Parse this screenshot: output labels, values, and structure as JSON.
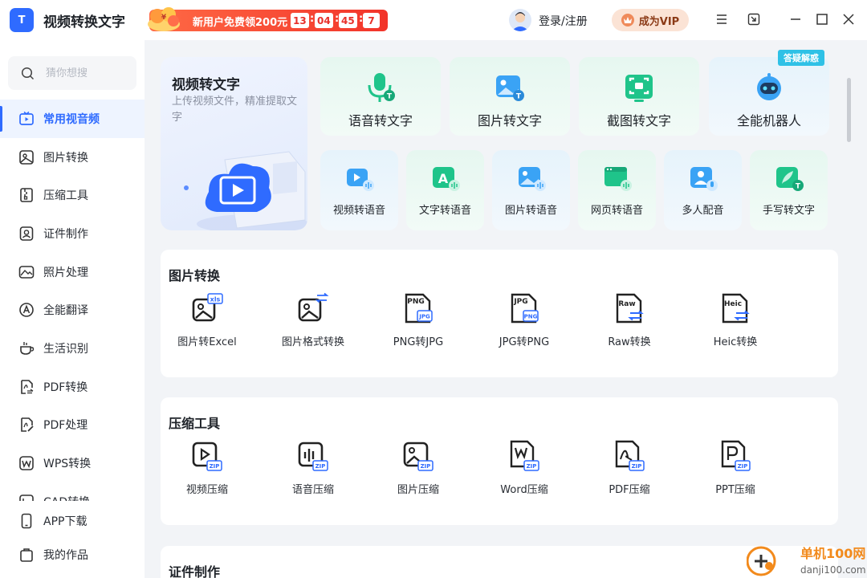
{
  "app": {
    "logo_text": "T",
    "title": "视频转换文字"
  },
  "promo": {
    "text_prefix": "新用户免费领",
    "amount": "200元",
    "timer": [
      "13",
      "04",
      "45",
      "7"
    ]
  },
  "header": {
    "login_label": "登录/注册",
    "vip_label": "成为VIP"
  },
  "sidebar": {
    "search_placeholder": "猜你想搜",
    "items": [
      {
        "label": "常用视音频",
        "icon": "video-icon",
        "active": true
      },
      {
        "label": "图片转换",
        "icon": "image-icon"
      },
      {
        "label": "压缩工具",
        "icon": "zip-icon"
      },
      {
        "label": "证件制作",
        "icon": "id-photo-icon"
      },
      {
        "label": "照片处理",
        "icon": "photo-icon"
      },
      {
        "label": "全能翻译",
        "icon": "translate-icon"
      },
      {
        "label": "生活识别",
        "icon": "cup-icon"
      },
      {
        "label": "PDF转换",
        "icon": "pdf-convert-icon"
      },
      {
        "label": "PDF处理",
        "icon": "pdf-edit-icon"
      },
      {
        "label": "WPS转换",
        "icon": "wps-icon"
      },
      {
        "label": "CAD转换",
        "icon": "cad-icon"
      }
    ],
    "bottom": [
      {
        "label": "APP下载",
        "icon": "phone-icon"
      },
      {
        "label": "我的作品",
        "icon": "bag-icon"
      }
    ]
  },
  "hero": {
    "title": "视频转文字",
    "description": "上传视频文件，精准提取文字"
  },
  "featured_big": [
    {
      "label": "语音转文字",
      "icon": "microphone-icon",
      "color": "#1fc48a"
    },
    {
      "label": "图片转文字",
      "icon": "image-text-icon",
      "color": "#3aa3f5"
    },
    {
      "label": "截图转文字",
      "icon": "screenshot-icon",
      "color": "#1fc48a"
    },
    {
      "label": "全能机器人",
      "icon": "robot-icon",
      "color": "#3aa3f5"
    }
  ],
  "badge_help": "答疑解惑",
  "featured_small": [
    {
      "label": "视频转语音",
      "icon": "video-voice-icon",
      "color": "#3aa3f5"
    },
    {
      "label": "文字转语音",
      "icon": "text-voice-icon",
      "color": "#1fc48a"
    },
    {
      "label": "图片转语音",
      "icon": "image-voice-icon",
      "color": "#3aa3f5"
    },
    {
      "label": "网页转语音",
      "icon": "web-voice-icon",
      "color": "#1fc48a"
    },
    {
      "label": "多人配音",
      "icon": "dubbing-icon",
      "color": "#3aa3f5"
    },
    {
      "label": "手写转文字",
      "icon": "handwriting-icon",
      "color": "#1fc48a"
    }
  ],
  "sections": [
    {
      "title": "图片转换",
      "tools": [
        {
          "label": "图片转Excel",
          "tag": "xls"
        },
        {
          "label": "图片格式转换",
          "tag": "⇄"
        },
        {
          "label": "PNG转JPG",
          "tag": "PNG/JPG"
        },
        {
          "label": "JPG转PNG",
          "tag": "JPG/PNG"
        },
        {
          "label": "Raw转换",
          "tag": "Raw"
        },
        {
          "label": "Heic转换",
          "tag": "Heic"
        }
      ]
    },
    {
      "title": "压缩工具",
      "tools": [
        {
          "label": "视频压缩",
          "tag": "ZIP"
        },
        {
          "label": "语音压缩",
          "tag": "ZIP"
        },
        {
          "label": "图片压缩",
          "tag": "ZIP"
        },
        {
          "label": "Word压缩",
          "tag": "ZIP"
        },
        {
          "label": "PDF压缩",
          "tag": "ZIP"
        },
        {
          "label": "PPT压缩",
          "tag": "ZIP"
        }
      ]
    },
    {
      "title": "证件制作"
    }
  ],
  "watermark": {
    "name": "单机100网",
    "url": "danji100.com"
  },
  "colors": {
    "accent": "#2f6bff",
    "green": "#1fc48a",
    "promo_red": "#f2342a"
  }
}
